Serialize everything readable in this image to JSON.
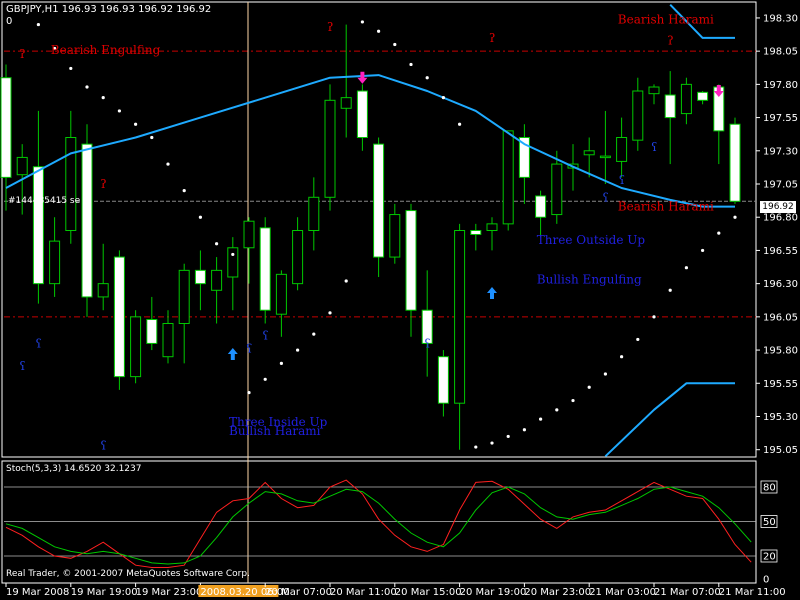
{
  "header": {
    "symbol_line": "GBPJPY,H1  196.93 196.93 196.92 196.92",
    "sub_line": "0"
  },
  "order_label": "#144485415 se",
  "price_box": "196.92",
  "stoch_label": "Stoch(5,3,3) 14.6520 32.1237",
  "copyright": "Real Trader, © 2001-2007 MetaQuotes Software Corp.",
  "colors": {
    "bull": "#ffffff",
    "bear": "#ffffff",
    "wick": "#00c800",
    "ma": "#1eaaff",
    "envelope": "#1eaaff",
    "dots": "#ffffff",
    "level_line": "#c80000",
    "stoch_main": "#ff2020",
    "stoch_signal": "#00c800",
    "bear_text": "#e00000",
    "bull_text": "#2020e0"
  },
  "patterns": [
    {
      "text": "Bearish Engulfing",
      "kind": "bear",
      "price": 198.03,
      "bar": 4
    },
    {
      "text": "Bearish Harami",
      "kind": "bear",
      "price": 198.26,
      "bar": 39
    },
    {
      "text": "Bearish Harami",
      "kind": "bear",
      "price": 196.85,
      "bar": 39
    },
    {
      "text": "Three Outside Up",
      "kind": "bull",
      "price": 196.6,
      "bar": 34
    },
    {
      "text": "Bullish Engulfing",
      "kind": "bull",
      "price": 196.3,
      "bar": 34
    },
    {
      "text": "Three Inside Up",
      "kind": "bull",
      "price": 195.23,
      "bar": 15
    },
    {
      "text": "Bullish Harami",
      "kind": "bull",
      "price": 195.16,
      "bar": 15
    }
  ],
  "chart_data": [
    {
      "type": "candlestick",
      "symbol": "GBPJPY",
      "timeframe": "H1",
      "ylim": [
        194.98,
        198.42
      ],
      "yticks": [
        198.3,
        198.05,
        197.8,
        197.55,
        197.3,
        197.05,
        196.8,
        196.55,
        196.3,
        196.05,
        195.8,
        195.55,
        195.3,
        195.05
      ],
      "xticks": [
        {
          "bar": 0,
          "label": "19 Mar 2008"
        },
        {
          "bar": 4,
          "label": "19 Mar 19:00"
        },
        {
          "bar": 8,
          "label": "19 Mar 23:00"
        },
        {
          "bar": 12,
          "label": "2008.03.20 06:00",
          "highlight": true
        },
        {
          "bar": 16,
          "label": "20 Mar 07:00"
        },
        {
          "bar": 20,
          "label": "20 Mar 11:00"
        },
        {
          "bar": 24,
          "label": "20 Mar 15:00"
        },
        {
          "bar": 28,
          "label": "20 Mar 19:00"
        },
        {
          "bar": 32,
          "label": "20 Mar 23:00"
        },
        {
          "bar": 36,
          "label": "21 Mar 03:00"
        },
        {
          "bar": 40,
          "label": "21 Mar 07:00"
        },
        {
          "bar": 44,
          "label": "21 Mar 11:00"
        }
      ],
      "candles": [
        {
          "o": 197.85,
          "h": 197.95,
          "l": 196.85,
          "c": 197.1
        },
        {
          "o": 197.12,
          "h": 197.35,
          "l": 196.82,
          "c": 197.25
        },
        {
          "o": 197.18,
          "h": 197.6,
          "l": 196.15,
          "c": 196.3
        },
        {
          "o": 196.3,
          "h": 196.8,
          "l": 196.2,
          "c": 196.62
        },
        {
          "o": 196.7,
          "h": 197.6,
          "l": 196.6,
          "c": 197.4
        },
        {
          "o": 197.35,
          "h": 197.5,
          "l": 196.05,
          "c": 196.2
        },
        {
          "o": 196.2,
          "h": 196.6,
          "l": 196.1,
          "c": 196.3
        },
        {
          "o": 196.5,
          "h": 196.55,
          "l": 195.5,
          "c": 195.6
        },
        {
          "o": 195.6,
          "h": 196.1,
          "l": 195.55,
          "c": 196.05
        },
        {
          "o": 196.03,
          "h": 196.2,
          "l": 195.8,
          "c": 195.85
        },
        {
          "o": 195.75,
          "h": 196.1,
          "l": 195.7,
          "c": 196.0
        },
        {
          "o": 196.0,
          "h": 196.45,
          "l": 195.7,
          "c": 196.4
        },
        {
          "o": 196.4,
          "h": 196.55,
          "l": 196.1,
          "c": 196.3
        },
        {
          "o": 196.25,
          "h": 196.5,
          "l": 196.0,
          "c": 196.4
        },
        {
          "o": 196.35,
          "h": 196.65,
          "l": 196.1,
          "c": 196.57
        },
        {
          "o": 196.57,
          "h": 196.8,
          "l": 196.3,
          "c": 196.77
        },
        {
          "o": 196.72,
          "h": 196.8,
          "l": 196.0,
          "c": 196.1
        },
        {
          "o": 196.07,
          "h": 196.4,
          "l": 195.9,
          "c": 196.37
        },
        {
          "o": 196.3,
          "h": 196.8,
          "l": 196.25,
          "c": 196.7
        },
        {
          "o": 196.7,
          "h": 197.1,
          "l": 196.55,
          "c": 196.95
        },
        {
          "o": 196.95,
          "h": 197.8,
          "l": 196.85,
          "c": 197.68
        },
        {
          "o": 197.62,
          "h": 198.25,
          "l": 197.4,
          "c": 197.7
        },
        {
          "o": 197.75,
          "h": 197.8,
          "l": 197.3,
          "c": 197.4
        },
        {
          "o": 197.35,
          "h": 197.4,
          "l": 196.35,
          "c": 196.5
        },
        {
          "o": 196.5,
          "h": 196.9,
          "l": 196.45,
          "c": 196.82
        },
        {
          "o": 196.85,
          "h": 196.9,
          "l": 195.9,
          "c": 196.1
        },
        {
          "o": 196.1,
          "h": 196.4,
          "l": 195.6,
          "c": 195.85
        },
        {
          "o": 195.75,
          "h": 195.8,
          "l": 195.3,
          "c": 195.4
        },
        {
          "o": 195.4,
          "h": 196.75,
          "l": 195.05,
          "c": 196.7
        },
        {
          "o": 196.7,
          "h": 196.75,
          "l": 196.55,
          "c": 196.67
        },
        {
          "o": 196.7,
          "h": 196.8,
          "l": 196.55,
          "c": 196.75
        },
        {
          "o": 196.75,
          "h": 197.45,
          "l": 196.7,
          "c": 197.45
        },
        {
          "o": 197.4,
          "h": 197.5,
          "l": 196.9,
          "c": 197.1
        },
        {
          "o": 196.96,
          "h": 197.0,
          "l": 196.65,
          "c": 196.8
        },
        {
          "o": 196.82,
          "h": 197.3,
          "l": 196.75,
          "c": 197.2
        },
        {
          "o": 197.17,
          "h": 197.35,
          "l": 197.0,
          "c": 197.2
        },
        {
          "o": 197.27,
          "h": 197.4,
          "l": 197.1,
          "c": 197.3
        },
        {
          "o": 197.25,
          "h": 197.6,
          "l": 197.05,
          "c": 197.26
        },
        {
          "o": 197.22,
          "h": 197.55,
          "l": 197.1,
          "c": 197.4
        },
        {
          "o": 197.38,
          "h": 197.85,
          "l": 197.3,
          "c": 197.75
        },
        {
          "o": 197.73,
          "h": 197.8,
          "l": 197.65,
          "c": 197.78
        },
        {
          "o": 197.72,
          "h": 197.9,
          "l": 197.2,
          "c": 197.55
        },
        {
          "o": 197.58,
          "h": 197.85,
          "l": 197.5,
          "c": 197.8
        },
        {
          "o": 197.74,
          "h": 197.75,
          "l": 197.65,
          "c": 197.68
        },
        {
          "o": 197.78,
          "h": 197.8,
          "l": 197.2,
          "c": 197.45
        },
        {
          "o": 197.5,
          "h": 197.55,
          "l": 196.9,
          "c": 196.92
        }
      ],
      "moving_average": [
        {
          "bar": 0,
          "v": 197.02
        },
        {
          "bar": 4,
          "v": 197.28
        },
        {
          "bar": 8,
          "v": 197.4
        },
        {
          "bar": 12,
          "v": 197.55
        },
        {
          "bar": 16,
          "v": 197.7
        },
        {
          "bar": 20,
          "v": 197.85
        },
        {
          "bar": 23,
          "v": 197.87
        },
        {
          "bar": 26,
          "v": 197.75
        },
        {
          "bar": 29,
          "v": 197.6
        },
        {
          "bar": 32,
          "v": 197.35
        },
        {
          "bar": 35,
          "v": 197.18
        },
        {
          "bar": 38,
          "v": 197.02
        },
        {
          "bar": 41,
          "v": 196.93
        },
        {
          "bar": 43,
          "v": 196.88
        },
        {
          "bar": 45,
          "v": 196.88
        }
      ],
      "upper_envelope": [
        {
          "bar": 41,
          "v": 198.4
        },
        {
          "bar": 43,
          "v": 198.15
        },
        {
          "bar": 45,
          "v": 198.15
        }
      ],
      "lower_envelope": [
        {
          "bar": 37,
          "v": 195.0
        },
        {
          "bar": 40,
          "v": 195.35
        },
        {
          "bar": 42,
          "v": 195.55
        },
        {
          "bar": 45,
          "v": 195.55
        }
      ],
      "sar_dots": [
        {
          "bar": 2,
          "v": 198.25
        },
        {
          "bar": 3,
          "v": 198.07
        },
        {
          "bar": 4,
          "v": 197.92
        },
        {
          "bar": 5,
          "v": 197.78
        },
        {
          "bar": 6,
          "v": 197.7
        },
        {
          "bar": 7,
          "v": 197.6
        },
        {
          "bar": 8,
          "v": 197.5
        },
        {
          "bar": 9,
          "v": 197.4
        },
        {
          "bar": 10,
          "v": 197.2
        },
        {
          "bar": 11,
          "v": 197.0
        },
        {
          "bar": 12,
          "v": 196.8
        },
        {
          "bar": 13,
          "v": 196.6
        },
        {
          "bar": 14,
          "v": 196.52
        },
        {
          "bar": 15,
          "v": 195.48
        },
        {
          "bar": 16,
          "v": 195.58
        },
        {
          "bar": 17,
          "v": 195.7
        },
        {
          "bar": 18,
          "v": 195.8
        },
        {
          "bar": 19,
          "v": 195.92
        },
        {
          "bar": 20,
          "v": 196.08
        },
        {
          "bar": 21,
          "v": 196.32
        },
        {
          "bar": 22,
          "v": 198.27
        },
        {
          "bar": 23,
          "v": 198.2
        },
        {
          "bar": 24,
          "v": 198.1
        },
        {
          "bar": 25,
          "v": 197.95
        },
        {
          "bar": 26,
          "v": 197.85
        },
        {
          "bar": 27,
          "v": 197.7
        },
        {
          "bar": 28,
          "v": 197.5
        },
        {
          "bar": 29,
          "v": 195.07
        },
        {
          "bar": 30,
          "v": 195.1
        },
        {
          "bar": 31,
          "v": 195.15
        },
        {
          "bar": 32,
          "v": 195.2
        },
        {
          "bar": 33,
          "v": 195.28
        },
        {
          "bar": 34,
          "v": 195.35
        },
        {
          "bar": 35,
          "v": 195.42
        },
        {
          "bar": 36,
          "v": 195.52
        },
        {
          "bar": 37,
          "v": 195.62
        },
        {
          "bar": 38,
          "v": 195.75
        },
        {
          "bar": 39,
          "v": 195.88
        },
        {
          "bar": 40,
          "v": 196.05
        },
        {
          "bar": 41,
          "v": 196.25
        },
        {
          "bar": 42,
          "v": 196.42
        },
        {
          "bar": 43,
          "v": 196.55
        },
        {
          "bar": 44,
          "v": 196.68
        },
        {
          "bar": 45,
          "v": 196.8
        }
      ],
      "horizontal_levels": [
        198.05,
        196.05
      ],
      "current_price": 196.92,
      "fractals_up": [
        {
          "bar": 1,
          "v": 198.0
        },
        {
          "bar": 6,
          "v": 197.02
        },
        {
          "bar": 20,
          "v": 198.2
        },
        {
          "bar": 30,
          "v": 198.12
        },
        {
          "bar": 41,
          "v": 198.1
        }
      ],
      "fractals_down": [
        {
          "bar": 2,
          "v": 195.82
        },
        {
          "bar": 1,
          "v": 195.65
        },
        {
          "bar": 6,
          "v": 195.05
        },
        {
          "bar": 15,
          "v": 195.78
        },
        {
          "bar": 16,
          "v": 195.88
        },
        {
          "bar": 26,
          "v": 195.82
        },
        {
          "bar": 37,
          "v": 196.92
        },
        {
          "bar": 38,
          "v": 197.05
        },
        {
          "bar": 40,
          "v": 197.3
        }
      ],
      "arrows_up": [
        {
          "bar": 14,
          "v": 195.77
        },
        {
          "bar": 30,
          "v": 196.23
        }
      ],
      "arrows_down": [
        {
          "bar": 22,
          "v": 197.85
        },
        {
          "bar": 44,
          "v": 197.75
        }
      ],
      "vertical_marker_bar": 15
    },
    {
      "type": "line",
      "title": "Stoch(5,3,3)",
      "ylim": [
        0,
        100
      ],
      "yticks": [
        80,
        50,
        20,
        0
      ],
      "series": [
        {
          "name": "Stoch(5,3,3)",
          "color": "red",
          "values": [
            45,
            38,
            28,
            20,
            18,
            24,
            32,
            22,
            12,
            10,
            10,
            12,
            35,
            58,
            68,
            70,
            84,
            70,
            62,
            64,
            80,
            86,
            74,
            52,
            38,
            28,
            24,
            30,
            60,
            84,
            85,
            78,
            65,
            52,
            44,
            54,
            58,
            60,
            68,
            76,
            84,
            78,
            72,
            70,
            52,
            30,
            14.65
          ]
        },
        {
          "name": "Signal",
          "color": "green",
          "values": [
            48,
            44,
            36,
            28,
            24,
            22,
            24,
            22,
            18,
            14,
            13,
            14,
            20,
            36,
            54,
            66,
            76,
            74,
            68,
            66,
            72,
            78,
            76,
            66,
            52,
            40,
            32,
            28,
            40,
            60,
            75,
            80,
            74,
            62,
            54,
            52,
            56,
            58,
            64,
            70,
            78,
            80,
            76,
            72,
            62,
            48,
            32.12
          ]
        }
      ]
    }
  ]
}
